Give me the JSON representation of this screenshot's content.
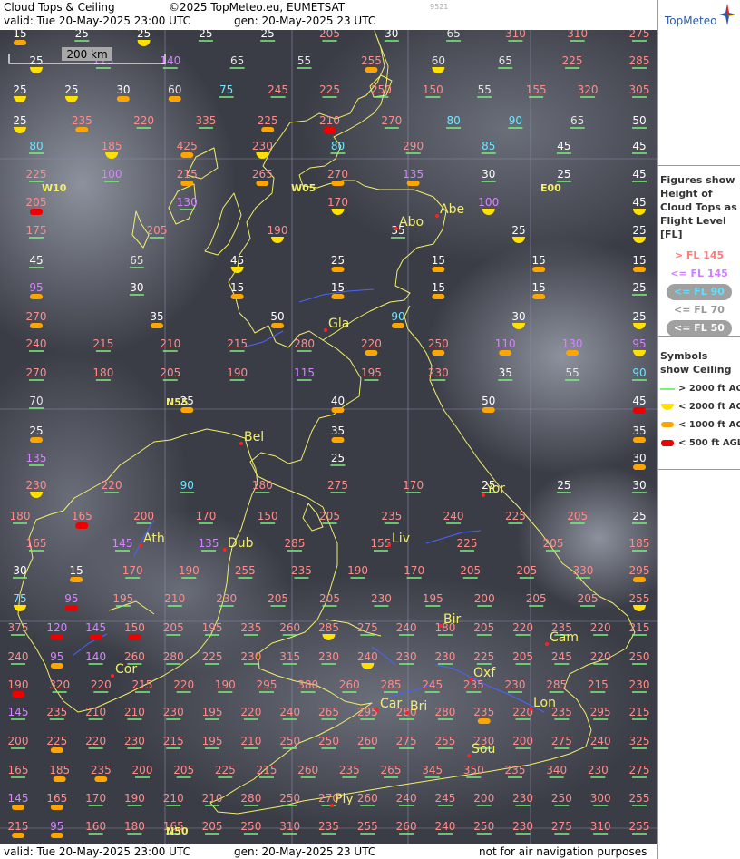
{
  "header": {
    "title": "Cloud Tops & Ceiling",
    "copyright": "©2025 TopMeteo.eu, EUMETSAT",
    "valid": "valid:  Tue   20-May-2025   23:00 UTC",
    "gen": "gen: 20-May-2025 23 UTC",
    "small_id": "9521"
  },
  "footer": {
    "valid": "valid:  Tue   20-May-2025   23:00 UTC",
    "gen": "gen:  20-May-2025 23 UTC",
    "disclaimer": "not for air navigation purposes"
  },
  "logo": {
    "text": "TopMeteo"
  },
  "scale_bar": "200 km",
  "grid_labels": [
    "W10",
    "W05",
    "E00",
    "N55",
    "N50"
  ],
  "cities": [
    "Abo",
    "Abe",
    "Gla",
    "Bel",
    "Yor",
    "Ath",
    "Dub",
    "Liv",
    "Bir",
    "Cam",
    "Cor",
    "Oxf",
    "Car",
    "Bri",
    "Lon",
    "Sou",
    "Ply"
  ],
  "legend_heights": {
    "title": "Figures show Height of Cloud Tops as Flight Level  [FL]",
    "items": [
      {
        "label": "> FL 145",
        "color": "#ff7b7b"
      },
      {
        "label": "<= FL 145",
        "color": "#d080ff"
      },
      {
        "label": "<= FL 90",
        "color": "#60e0ff"
      },
      {
        "label": "<= FL 70",
        "color": "#d8d8d8"
      },
      {
        "label": "<= FL 50",
        "color": "#ffffff"
      }
    ]
  },
  "legend_ceiling": {
    "title": "Symbols show Ceiling",
    "items": [
      {
        "label": "> 2000 ft AGL",
        "color": "#7df07d"
      },
      {
        "label": "< 2000 ft AGL",
        "color": "#ffe000"
      },
      {
        "label": "< 1000 ft AGL",
        "color": "#ffa500"
      },
      {
        "label": "< 500 ft AGL",
        "color": "#ee0000"
      }
    ]
  },
  "colors": {
    "high": "#ff8c8c",
    "mid": "#d585ff",
    "low": "#6fe6ff",
    "lower": "#e6e6e6",
    "lowest": "#ffffff",
    "coast": "#f2ef6a",
    "river": "#4d62ff",
    "grid": "#8a8aa8"
  },
  "station_rows": [
    "15z 25g 25y 25g 25g 205g 30g 65g 310g 310g 275g",
    "25y 125g 140g 65g 55g 255o 60y 65g 225g 285g",
    "25y 25y 30o 60o 75g 245g 225g 250g 150g 55g 155g 320g 305g",
    "25y 235o 220g 335g 225o 210r 270g 80g 90g 65g 50g",
    "80g 185y 425o 230y 80g 290g 85g 45g 45g",
    "225g 100g 215o 265o 270o 135o 30g 25g 45g",
    "205r 130g 170y 100y 45y",
    "175g 205g 190y 35g 25y 25y",
    "45g 65g 45y 25o 15o 15o 15o",
    "95o 30g 15o 15o 15o 15o 25g",
    "270o 35o 50o 90o 30y 25y",
    "240g 215g 210g 215g 280g 220o 250o 110o 130o 95y",
    "270g 180g 205g 190g 115g 195g 230g 35g 55g 90g",
    "70g 25o 40o 50o 45r",
    "25o 35o 35o",
    "135g 25g 30o",
    "230y 220g 90g 180g 275g 170g 25g 25g 30g",
    "180g 165r 200g 170g 150g 205g 235g 240g 225g 205g 25g",
    "165g 145g 135g 285g 155g 225g 205g 185g",
    "30g 15o 170g 190g 255g 235g 190g 170g 205g 205g 330g 295o",
    "75y 95r 195g 210g 230g 205g 205g 230g 195g 200g 205g 205g 255y",
    "375g 120r 145r 150r 205g 195g 235g 260g 285y 275g 240g 180g 205g 220g 235g 220g 215g",
    "240g 95o 140g 260g 280g 225g 230g 315g 230g 240y 230g 230g 225g 205g 245g 220g 250g",
    "190r 320g 220g 215g 220g 190g 295g 380g 260g 285g 245g 235g 230g 285g 215g 230g",
    "145g 235g 210g 210g 230g 195g 220g 240g 265g 295g 280g 280g 235o 220g 235g 295g 215g",
    "200g 225o 220g 230g 215g 195g 210g 250g 250g 260g 275g 255g 230g 200g 275g 240g 325g",
    "165g 185o 235o 200g 205g 225g 215g 260g 235g 265g 345g 350g 235g 340g 230g 275g",
    "145o 165o 170g 190g 210g 210g 280g 250g 270g 260g 240g 245g 200g 230g 250g 300g 255g",
    "215o 95o 160g 180g 165g 205g 250g 310g 235g 255g 260g 240g 250g 230g 275g 310g 255g"
  ]
}
